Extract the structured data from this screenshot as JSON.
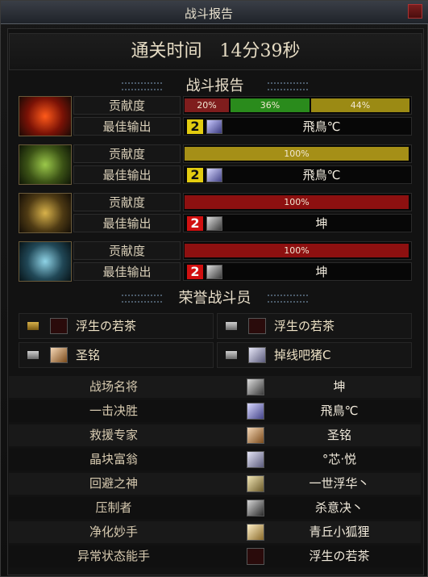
{
  "window": {
    "title": "战斗报告"
  },
  "clear_time": "通关时间　14分39秒",
  "battle_report_title": "战斗报告",
  "labels": {
    "contribution": "贡献度",
    "best_output": "最佳输出"
  },
  "teams": [
    {
      "bars": [
        {
          "text": "20%",
          "value": 0.2,
          "color": "#7f1d1d"
        },
        {
          "text": "36%",
          "value": 0.36,
          "color": "#2a8b1c"
        },
        {
          "text": "44%",
          "value": 0.44,
          "color": "#9b8a14"
        }
      ],
      "best": {
        "rank": "2",
        "rank_color": "yellow",
        "name": "飛鳥℃"
      }
    },
    {
      "bars": [
        {
          "text": "100%",
          "value": 1.0,
          "color": "#a58f17"
        }
      ],
      "best": {
        "rank": "2",
        "rank_color": "yellow",
        "name": "飛鳥℃"
      }
    },
    {
      "bars": [
        {
          "text": "100%",
          "value": 1.0,
          "color": "#8d1010"
        }
      ],
      "best": {
        "rank": "2",
        "rank_color": "red",
        "name": "坤"
      }
    },
    {
      "bars": [
        {
          "text": "100%",
          "value": 1.0,
          "color": "#8d1010"
        }
      ],
      "best": {
        "rank": "2",
        "rank_color": "red",
        "name": "坤"
      }
    }
  ],
  "honor_title": "荣誉战斗员",
  "honor": [
    {
      "name": "浮生の若茶"
    },
    {
      "name": "浮生の若茶"
    },
    {
      "name": "圣铭"
    },
    {
      "name": "掉线吧猪C"
    }
  ],
  "awards": [
    {
      "title": "战场名将",
      "player": "坤"
    },
    {
      "title": "一击决胜",
      "player": "飛鳥℃"
    },
    {
      "title": "救援专家",
      "player": "圣铭"
    },
    {
      "title": "晶块富翁",
      "player": "°芯·悦"
    },
    {
      "title": "回避之神",
      "player": "一世浮华丶"
    },
    {
      "title": "压制者",
      "player": "杀意决丶"
    },
    {
      "title": "净化妙手",
      "player": "青丘小狐狸"
    },
    {
      "title": "异常状态能手",
      "player": "浮生の若茶"
    }
  ],
  "colors": {
    "accent": "#e3cc10",
    "danger": "#d01010",
    "frame": "#2e2e2e"
  }
}
